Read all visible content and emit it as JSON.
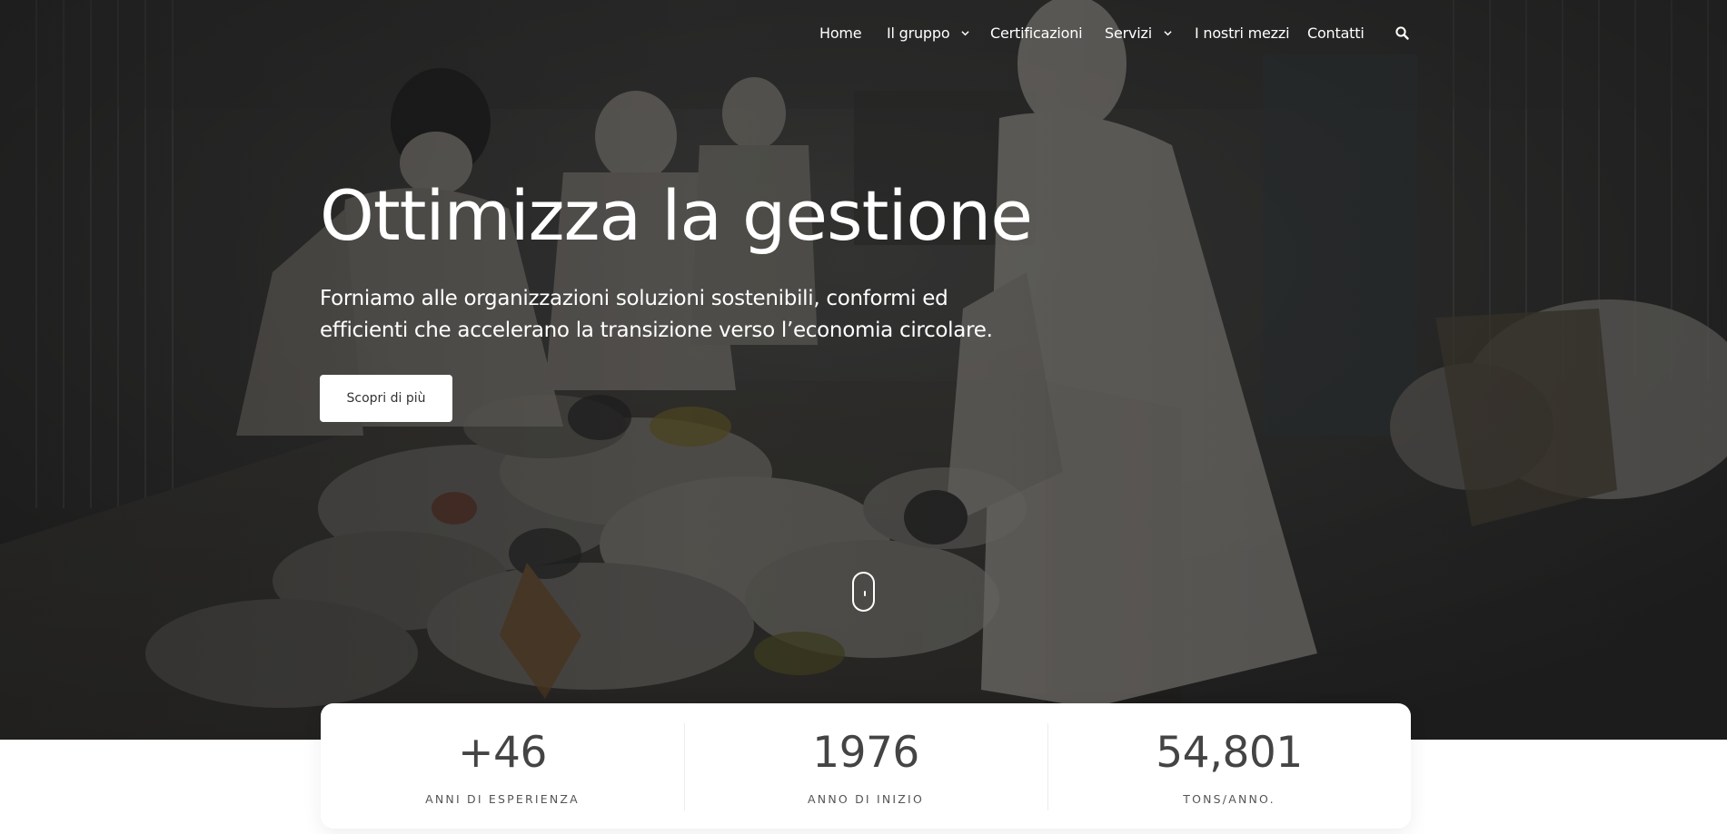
{
  "nav": {
    "items": [
      {
        "label": "Home",
        "has_dropdown": false
      },
      {
        "label": "Il gruppo",
        "has_dropdown": true
      },
      {
        "label": "Certificazioni",
        "has_dropdown": false
      },
      {
        "label": "Servizi",
        "has_dropdown": true
      },
      {
        "label": "I nostri mezzi",
        "has_dropdown": false
      },
      {
        "label": "Contatti",
        "has_dropdown": false
      }
    ],
    "search_icon": "search-icon"
  },
  "hero": {
    "title": "Ottimizza la gestione",
    "subtitle": "Forniamo alle organizzazioni soluzioni sostenibili, conformi ed efficienti che accelerano la transizione verso l’economia circolare.",
    "cta_label": "Scopri di più",
    "scroll_icon": "scroll-mouse-icon"
  },
  "stats": [
    {
      "value": "+46",
      "label": "ANNI DI ESPERIENZA"
    },
    {
      "value": "1976",
      "label": "ANNO DI INIZIO"
    },
    {
      "value": "54,801",
      "label": "TONS/ANNO."
    }
  ],
  "colors": {
    "hero_overlay": "#2b2b2b",
    "text_light": "#ffffff",
    "stat_value": "#444444",
    "stat_label": "#555555"
  }
}
